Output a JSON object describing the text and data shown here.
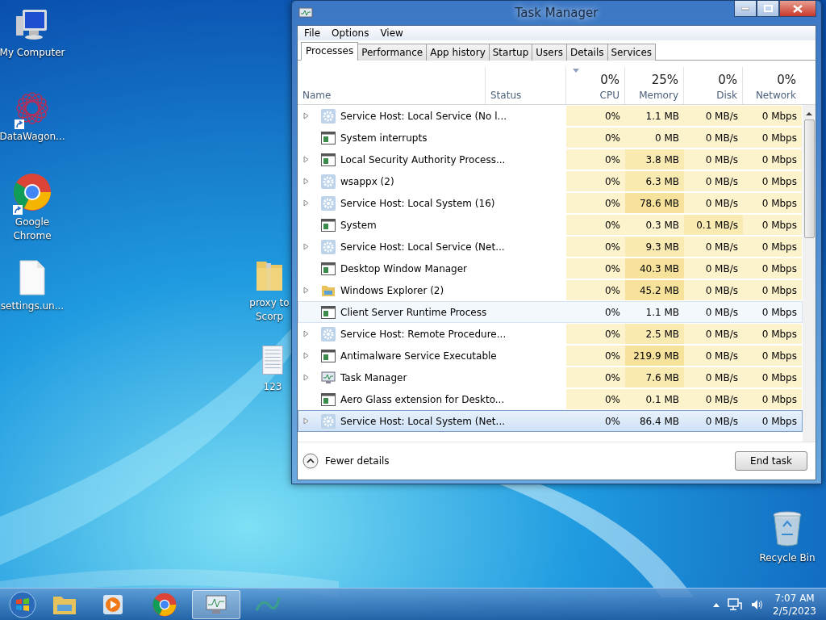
{
  "desktop_icons": [
    {
      "kind": "computer",
      "label": [
        "My Computer"
      ],
      "shortcut": false
    },
    {
      "kind": "web",
      "label": [
        "DataWagon..."
      ],
      "shortcut": true
    },
    {
      "kind": "chrome",
      "label": [
        "Google",
        "Chrome"
      ],
      "shortcut": true
    },
    {
      "kind": "file",
      "label": [
        "settings.un..."
      ],
      "shortcut": false
    },
    {
      "kind": "folder",
      "label": [
        "proxy to",
        "Scorp"
      ],
      "shortcut": false
    },
    {
      "kind": "notepad",
      "label": [
        "123"
      ],
      "shortcut": false
    },
    {
      "kind": "recycle",
      "label": [
        "Recycle Bin"
      ],
      "shortcut": false
    }
  ],
  "window": {
    "title": "Task Manager",
    "menu": [
      "File",
      "Options",
      "View"
    ],
    "tabs": [
      {
        "label": "Processes",
        "selected": true
      },
      {
        "label": "Performance",
        "selected": false
      },
      {
        "label": "App history",
        "selected": false
      },
      {
        "label": "Startup",
        "selected": false
      },
      {
        "label": "Users",
        "selected": false
      },
      {
        "label": "Details",
        "selected": false
      },
      {
        "label": "Services",
        "selected": false
      }
    ],
    "columns": [
      {
        "label": "Name",
        "sorted": false
      },
      {
        "label": "Status",
        "sorted": false
      },
      {
        "label": "CPU",
        "usage": "0%",
        "sorted": true
      },
      {
        "label": "Memory",
        "usage": "25%",
        "sorted": false
      },
      {
        "label": "Disk",
        "usage": "0%",
        "sorted": false
      },
      {
        "label": "Network",
        "usage": "0%",
        "sorted": false
      }
    ],
    "rows": [
      {
        "kind": "service",
        "expandable": true,
        "name": "Service Host: Local Service (No l...",
        "cpu": "0%",
        "memory": "1.1 MB",
        "disk": "0 MB/s",
        "network": "0 Mbps",
        "hovered": false,
        "selected": false
      },
      {
        "kind": "app",
        "expandable": false,
        "name": "System interrupts",
        "cpu": "0%",
        "memory": "0 MB",
        "disk": "0 MB/s",
        "network": "0 Mbps",
        "hovered": false,
        "selected": false
      },
      {
        "kind": "app",
        "expandable": true,
        "name": "Local Security Authority Process...",
        "cpu": "0%",
        "memory": "3.8 MB",
        "disk": "0 MB/s",
        "network": "0 Mbps",
        "hovered": false,
        "selected": false
      },
      {
        "kind": "service",
        "expandable": true,
        "name": "wsappx (2)",
        "cpu": "0%",
        "memory": "6.3 MB",
        "disk": "0 MB/s",
        "network": "0 Mbps",
        "hovered": false,
        "selected": false
      },
      {
        "kind": "service",
        "expandable": true,
        "name": "Service Host: Local System (16)",
        "cpu": "0%",
        "memory": "78.6 MB",
        "disk": "0 MB/s",
        "network": "0 Mbps",
        "hovered": false,
        "selected": false
      },
      {
        "kind": "app",
        "expandable": false,
        "name": "System",
        "cpu": "0%",
        "memory": "0.3 MB",
        "disk": "0.1 MB/s",
        "network": "0 Mbps",
        "hovered": false,
        "selected": false
      },
      {
        "kind": "service",
        "expandable": true,
        "name": "Service Host: Local Service (Net...",
        "cpu": "0%",
        "memory": "9.3 MB",
        "disk": "0 MB/s",
        "network": "0 Mbps",
        "hovered": false,
        "selected": false
      },
      {
        "kind": "app",
        "expandable": false,
        "name": "Desktop Window Manager",
        "cpu": "0%",
        "memory": "40.3 MB",
        "disk": "0 MB/s",
        "network": "0 Mbps",
        "hovered": false,
        "selected": false
      },
      {
        "kind": "explorer",
        "expandable": true,
        "name": "Windows Explorer (2)",
        "cpu": "0%",
        "memory": "45.2 MB",
        "disk": "0 MB/s",
        "network": "0 Mbps",
        "hovered": false,
        "selected": false
      },
      {
        "kind": "app",
        "expandable": false,
        "name": "Client Server Runtime Process",
        "cpu": "0%",
        "memory": "1.1 MB",
        "disk": "0 MB/s",
        "network": "0 Mbps",
        "hovered": true,
        "selected": false
      },
      {
        "kind": "service",
        "expandable": true,
        "name": "Service Host: Remote Procedure...",
        "cpu": "0%",
        "memory": "2.5 MB",
        "disk": "0 MB/s",
        "network": "0 Mbps",
        "hovered": false,
        "selected": false
      },
      {
        "kind": "app",
        "expandable": true,
        "name": "Antimalware Service Executable",
        "cpu": "0%",
        "memory": "219.9 MB",
        "disk": "0 MB/s",
        "network": "0 Mbps",
        "hovered": false,
        "selected": false
      },
      {
        "kind": "monitor",
        "expandable": true,
        "name": "Task Manager",
        "cpu": "0%",
        "memory": "7.6 MB",
        "disk": "0 MB/s",
        "network": "0 Mbps",
        "hovered": false,
        "selected": false
      },
      {
        "kind": "app",
        "expandable": false,
        "name": "Aero Glass extension for Deskto...",
        "cpu": "0%",
        "memory": "0.1 MB",
        "disk": "0 MB/s",
        "network": "0 Mbps",
        "hovered": false,
        "selected": false
      },
      {
        "kind": "service",
        "expandable": true,
        "name": "Service Host: Local System (Net...",
        "cpu": "0%",
        "memory": "86.4 MB",
        "disk": "0 MB/s",
        "network": "0 Mbps",
        "hovered": false,
        "selected": true
      }
    ],
    "fewer_details": "Fewer details",
    "end_task": "End task"
  },
  "taskbar": {
    "items": [
      {
        "kind": "explorer",
        "active": false
      },
      {
        "kind": "media",
        "active": false
      },
      {
        "kind": "chrome",
        "active": false
      },
      {
        "kind": "monitor",
        "active": true
      },
      {
        "kind": "wave",
        "active": false
      }
    ],
    "time": "7:07 AM",
    "date": "2/5/2023"
  }
}
